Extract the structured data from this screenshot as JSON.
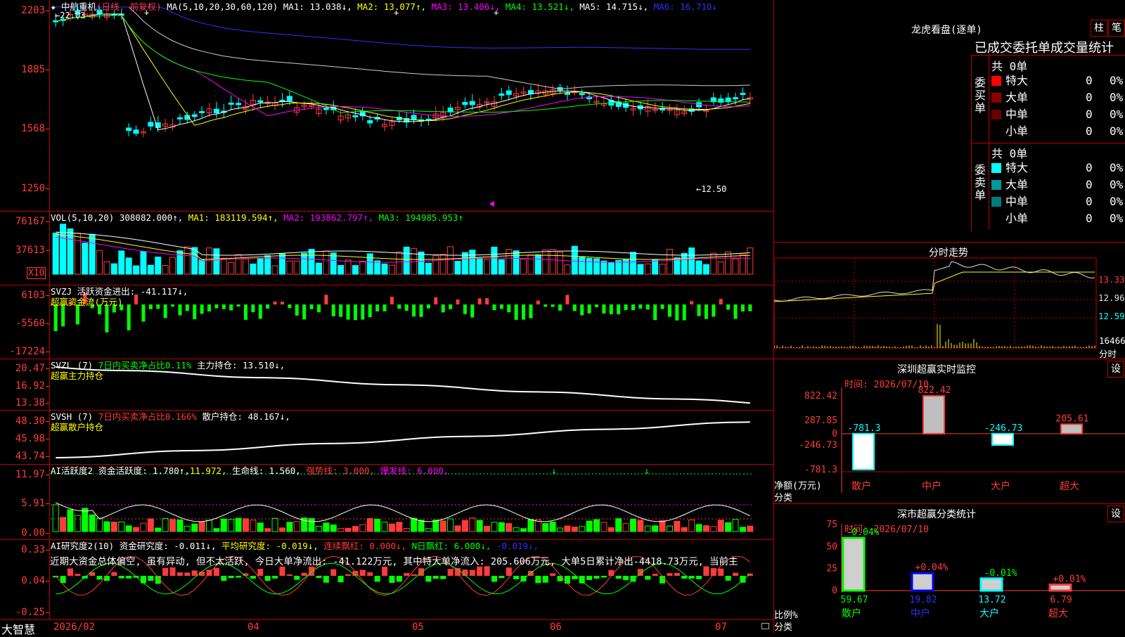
{
  "colors": {
    "red": "#ff3b3b",
    "cyan": "#00ffff",
    "green": "#00ff00",
    "yellow": "#ffff00",
    "magenta": "#ff00ff",
    "blue": "#3030ff",
    "border": "#c00000"
  },
  "kline": {
    "header_name": "★ 中航重机",
    "header_mode": "(日线, 前复权)",
    "header_ma": "MA(5,10,20,30,60,120)",
    "ma1": "MA1: 13.038↓,",
    "ma2": "MA2: 13.077↑,",
    "ma3": "MA3: 13.406↓,",
    "ma4": "MA4: 13.521↓,",
    "ma5": "MA5: 14.715↓,",
    "ma6": "MA6: 16.710↓",
    "high_label": "←22.03",
    "low_label": "←12.50",
    "yticks": [
      "2203",
      "1885",
      "1568",
      "1250"
    ]
  },
  "vol": {
    "header": "VOL(5,10,20)",
    "value": "308082.000↑,",
    "ma1": "MA1: 183119.594↑,",
    "ma2": "MA2: 193862.797↑,",
    "ma3": "MA3: 194985.953↑",
    "yticks": [
      "76167",
      "37613"
    ],
    "unit": "X10"
  },
  "svzj": {
    "header": "SVZJ",
    "label": "活跃资金进出: -41.117↓,",
    "sub": "超赢资金流(万元)",
    "yticks": [
      "6103",
      "-5560",
      "-17224"
    ]
  },
  "svzl": {
    "header": "SVZL (7)",
    "ratio": "7日内买卖净占比0.11%",
    "label": "主力持仓: 13.510↓,",
    "sub": "超赢主力持仓",
    "yticks": [
      "20.47",
      "16.92",
      "13.38"
    ]
  },
  "svsh": {
    "header": "SVSH (7)",
    "ratio": "7日内买卖净占比0.166%",
    "label": "散户持仓: 48.167↓,",
    "sub": "超赢散户持仓",
    "yticks": [
      "48.30",
      "45.98",
      "43.74"
    ]
  },
  "ai1": {
    "header": "AI活跃度2",
    "l1": "资金活跃度: 1.780↑,",
    "l2": "11.972,",
    "l3": "生命线: 1.560,",
    "l4": "强势线: 3.000,",
    "l5": "爆发线: 6.000,",
    "yticks": [
      "11.97",
      "5.91",
      "0.00"
    ]
  },
  "ai2": {
    "header": "AI研究度2(10)",
    "l1": "资金研究度: -0.011↓,",
    "l2": "平均研究度: -0.019↓,",
    "l3": "连续飘红: 0.000↓,",
    "l4": "N日飘红: 6.000↓,",
    "l5": "-0.019↓,",
    "comment": "近期大资金总体偏空, 虽有异动, 但不太活跃, 今日大单净流出: -41.122万元, 其中特大单净流入: 205.606万元, 大单5日累计净出-4418.73万元, 当前主",
    "yticks": [
      "0.33",
      "0.04",
      "-0.25"
    ]
  },
  "xaxis": {
    "brand": "大智慧",
    "labels": [
      "2026/02",
      "04",
      "05",
      "06",
      "07"
    ]
  },
  "dragon": {
    "title": "龙虎看盘(逐单)",
    "btn1": "柱",
    "btn2": "笔",
    "subtitle": "已成交委托单成交量统计",
    "buy_label": "委买单",
    "sell_label": "委卖单",
    "buy_total": "共 0单",
    "sell_total": "共 0单",
    "buy_rows": [
      {
        "name": "特大",
        "count": "0",
        "pct": "0%",
        "color": "#ff0000"
      },
      {
        "name": "大单",
        "count": "0",
        "pct": "0%",
        "color": "#8b0000"
      },
      {
        "name": "中单",
        "count": "0",
        "pct": "0%",
        "color": "#6b0000"
      },
      {
        "name": "小单",
        "count": "0",
        "pct": "0%",
        "color": "#000000"
      }
    ],
    "sell_rows": [
      {
        "name": "特大",
        "count": "0",
        "pct": "0%",
        "color": "#00ffff"
      },
      {
        "name": "大单",
        "count": "0",
        "pct": "0%",
        "color": "#009999"
      },
      {
        "name": "中单",
        "count": "0",
        "pct": "0%",
        "color": "#007a7a"
      },
      {
        "name": "小单",
        "count": "0",
        "pct": "0%",
        "color": "#000000"
      }
    ]
  },
  "intraday": {
    "title": "分时走势",
    "prices": [
      "13.33",
      "12.96",
      "12.59"
    ],
    "vol": "16466",
    "unit": "分时"
  },
  "monitor": {
    "title": "深圳超赢实时监控",
    "btn": "设",
    "date": "时间: 2026/07/10",
    "yticks": [
      "822.42",
      "287.85",
      "0",
      "-246.73",
      "-781.3"
    ],
    "ylabel": "净额(万元)",
    "xlabel": "分类",
    "categories": [
      "散户",
      "中户",
      "大户",
      "超大"
    ],
    "values": [
      -781.3,
      822.42,
      -246.73,
      205.61
    ],
    "value_labels": [
      "-781.3",
      "822.42",
      "-246.73",
      "205.61"
    ]
  },
  "classify": {
    "title": "深市超赢分类统计",
    "btn": "设",
    "date": "时间: 2026/07/10",
    "yticks": [
      "75",
      "50",
      "25",
      "0"
    ],
    "ylabel": "比例%",
    "xlabel": "分类",
    "categories": [
      "散户",
      "中户",
      "大户",
      "超大"
    ],
    "values": [
      59.67,
      19.82,
      13.72,
      6.79
    ],
    "value_labels": [
      "59.67",
      "19.82",
      "13.72",
      "6.79"
    ],
    "delta_labels": [
      "-0.04%",
      "+0.04%",
      "-0.01%",
      "+0.01%"
    ]
  },
  "chart_data": [
    {
      "type": "bar",
      "title": "深圳超赢实时监控",
      "ylabel": "净额(万元)",
      "xlabel": "分类",
      "categories": [
        "散户",
        "中户",
        "大户",
        "超大"
      ],
      "values": [
        -781.3,
        822.42,
        -246.73,
        205.61
      ],
      "ylim": [
        -781.3,
        822.42
      ]
    },
    {
      "type": "bar",
      "title": "深市超赢分类统计",
      "ylabel": "比例%",
      "xlabel": "分类",
      "categories": [
        "散户",
        "中户",
        "大户",
        "超大"
      ],
      "values": [
        59.67,
        19.82,
        13.72,
        6.79
      ],
      "ylim": [
        0,
        75
      ]
    }
  ]
}
